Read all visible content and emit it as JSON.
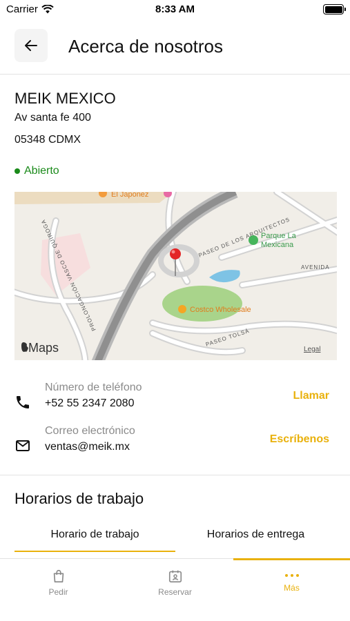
{
  "status_bar": {
    "carrier": "Carrier",
    "time": "8:33 AM"
  },
  "header": {
    "title": "Acerca de nosotros"
  },
  "business": {
    "name": "MEIK MEXICO",
    "address_line1": "Av santa fe 400",
    "address_line2": "05348 CDMX",
    "status": "Abierto"
  },
  "map": {
    "labels": {
      "poi_top": "El Japonez",
      "park": "Parque La Mexicana",
      "park_line1": "Parque La",
      "park_line2": "Mexicana",
      "costco": "Costco Wholesale",
      "road_arquitectos": "PASEO DE LOS ARQUITECTOS",
      "road_avenida": "AVENIDA",
      "road_quiroga": "PROLONGACIÓN VASCO DE QUIROGA",
      "road_tolsa": "PASEO TOLSÁ",
      "brand": "Maps",
      "legal": "Legal"
    }
  },
  "contact": {
    "phone": {
      "label": "Número de teléfono",
      "value": "+52 55 2347 2080",
      "action": "Llamar"
    },
    "email": {
      "label": "Correo electrónico",
      "value": "ventas@meik.mx",
      "action": "Escríbenos"
    }
  },
  "hours": {
    "title": "Horarios de trabajo",
    "tabs": [
      {
        "label": "Horario de trabajo"
      },
      {
        "label": "Horarios de entrega"
      }
    ]
  },
  "bottom_nav": {
    "items": [
      {
        "label": "Pedir"
      },
      {
        "label": "Reservar"
      },
      {
        "label": "Más"
      }
    ],
    "active": "Más"
  },
  "colors": {
    "accent": "#e9b10c",
    "open": "#1a8a1a",
    "muted": "#8a8a8a"
  }
}
